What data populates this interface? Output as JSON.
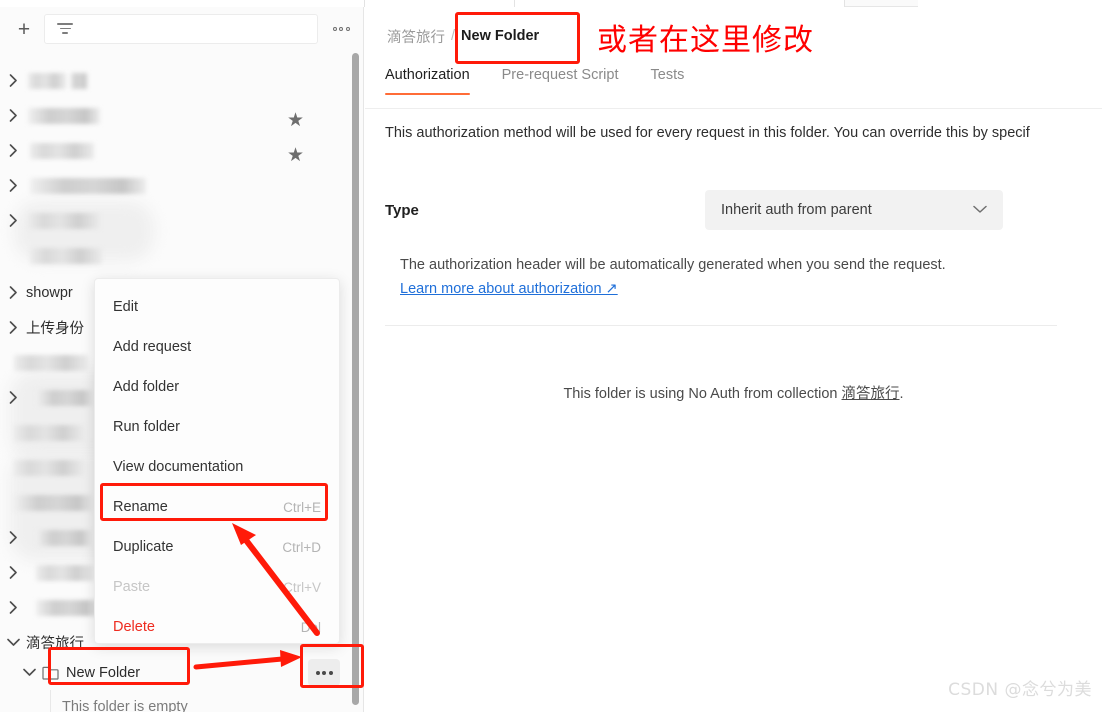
{
  "sidebar": {
    "toolbar": {
      "add_label": "+",
      "filter_icon": "filter-icon",
      "more_icon": "more-horizontal-icon"
    },
    "items": [
      {
        "label": "",
        "redacted": true,
        "chevron": "right",
        "starred": true
      },
      {
        "label": "",
        "redacted": true,
        "chevron": "right",
        "starred": true
      },
      {
        "label": "",
        "redacted": true,
        "chevron": "right",
        "starred": false
      },
      {
        "label": "",
        "redacted": true,
        "chevron": "right",
        "starred": false
      },
      {
        "label": "",
        "redacted": true,
        "chevron": "right",
        "starred": false
      },
      {
        "label": "",
        "redacted": true,
        "chevron": "none",
        "starred": false
      },
      {
        "label": "showpr",
        "redacted": false,
        "chevron": "right",
        "starred": false
      },
      {
        "label": "上传身份",
        "redacted": false,
        "chevron": "right",
        "starred": false
      },
      {
        "label": "",
        "redacted": true,
        "chevron": "none",
        "starred": false
      },
      {
        "label": "",
        "redacted": true,
        "chevron": "right",
        "starred": false
      },
      {
        "label": "",
        "redacted": true,
        "chevron": "none",
        "starred": false
      },
      {
        "label": "",
        "redacted": true,
        "chevron": "none",
        "starred": false
      },
      {
        "label": "",
        "redacted": true,
        "chevron": "none",
        "starred": false
      },
      {
        "label": "",
        "redacted": true,
        "chevron": "right",
        "starred": false
      },
      {
        "label": "",
        "redacted": true,
        "chevron": "right",
        "starred": false
      },
      {
        "label": "",
        "redacted": true,
        "chevron": "right",
        "starred": false
      }
    ],
    "collection": {
      "label": "滴答旅行",
      "chevron": "down"
    },
    "folder": {
      "label": "New Folder",
      "chevron": "down",
      "icon": "folder-icon"
    },
    "empty_note": "This folder is empty",
    "folder_more_icon": "more-horizontal-icon"
  },
  "context_menu": {
    "items": [
      {
        "label": "Edit",
        "shortcut": "",
        "state": "normal"
      },
      {
        "label": "Add request",
        "shortcut": "",
        "state": "normal"
      },
      {
        "label": "Add folder",
        "shortcut": "",
        "state": "normal"
      },
      {
        "label": "Run folder",
        "shortcut": "",
        "state": "normal"
      },
      {
        "label": "View documentation",
        "shortcut": "",
        "state": "normal"
      },
      {
        "label": "Rename",
        "shortcut": "Ctrl+E",
        "state": "normal"
      },
      {
        "label": "Duplicate",
        "shortcut": "Ctrl+D",
        "state": "normal"
      },
      {
        "label": "Paste",
        "shortcut": "Ctrl+V",
        "state": "disabled"
      },
      {
        "label": "Delete",
        "shortcut": "Del",
        "state": "danger"
      }
    ]
  },
  "main": {
    "breadcrumb": {
      "collection": "滴答旅行",
      "separator": "/",
      "name": "New Folder"
    },
    "annotation_cn": "或者在这里修改",
    "tabs": [
      {
        "label": "Authorization",
        "active": true
      },
      {
        "label": "Pre-request Script",
        "active": false
      },
      {
        "label": "Tests",
        "active": false
      }
    ],
    "description": "This authorization method will be used for every request in this folder. You can override this by specif",
    "type_label": "Type",
    "type_value": "Inherit auth from parent",
    "type_chevron": "chevron-down-icon",
    "auth_note": "The authorization header will be automatically generated when you send the request.",
    "auth_link": "Learn more about authorization ↗",
    "no_auth_prefix": "This folder is using No Auth from collection ",
    "no_auth_collection": "滴答旅行",
    "no_auth_suffix": "."
  },
  "watermark": "CSDN @念兮为美",
  "colors": {
    "accent": "#ff6c37",
    "annotation": "#ff1a09",
    "link": "#1f6fd9",
    "danger": "#ee2b1f"
  }
}
